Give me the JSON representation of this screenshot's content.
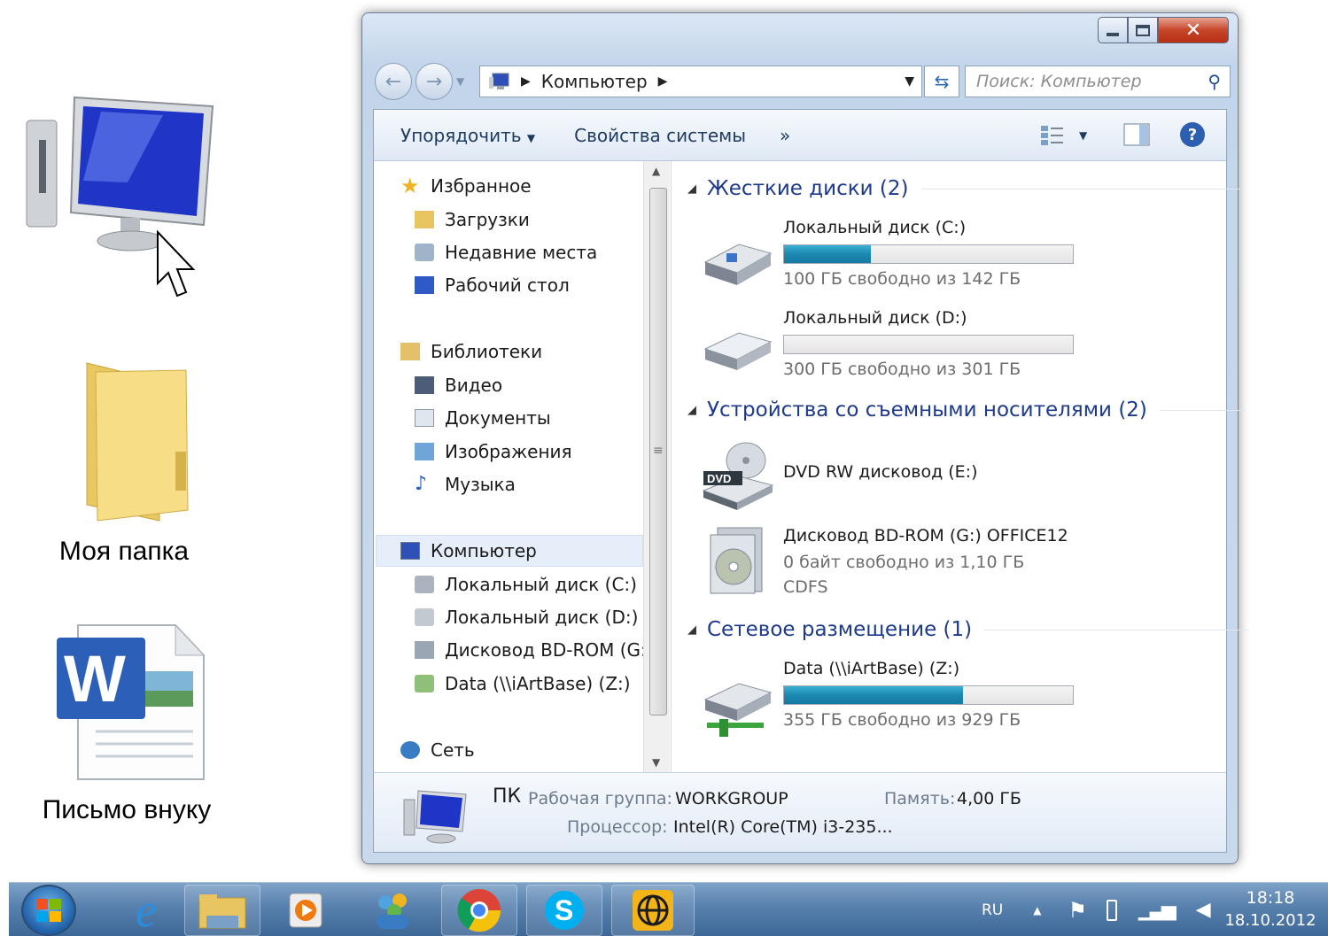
{
  "desktop": {
    "icons": [
      {
        "label": "",
        "icon": "computer-icon"
      },
      {
        "label": "Моя папка",
        "icon": "folder-icon"
      },
      {
        "label": "Письмо внуку",
        "icon": "word-document-icon"
      }
    ]
  },
  "window": {
    "address": {
      "path": "Компьютер"
    },
    "search": {
      "placeholder": "Поиск: Компьютер"
    },
    "toolbar": {
      "organize": "Упорядочить",
      "system_properties": "Свойства системы",
      "more": "»"
    },
    "nav": {
      "favorites": "Избранное",
      "downloads": "Загрузки",
      "recent": "Недавние места",
      "desktop": "Рабочий стол",
      "libraries": "Библиотеки",
      "video": "Видео",
      "documents": "Документы",
      "pictures": "Изображения",
      "music": "Музыка",
      "computer": "Компьютер",
      "disk_c": "Локальный диск (C:)",
      "disk_d": "Локальный диск (D:)",
      "bd_rom": "Дисковод BD-ROM (G:)",
      "network_drive": "Data (\\\\iArtBase) (Z:)",
      "network": "Сеть"
    },
    "groups": {
      "hard_drives": "Жесткие диски (2)",
      "removable": "Устройства со съемными носителями (2)",
      "network_locations": "Сетевое размещение (1)"
    },
    "drives": {
      "c": {
        "name": "Локальный диск (C:)",
        "free": "100 ГБ свободно из 142 ГБ",
        "used_fraction": 0.3
      },
      "d": {
        "name": "Локальный диск (D:)",
        "free": "300 ГБ свободно из 301 ГБ",
        "used_fraction": 0.0
      },
      "e": {
        "name": "DVD RW дисковод (E:)",
        "badge": "DVD"
      },
      "g": {
        "name": "Дисковод BD-ROM (G:) OFFICE12",
        "free": "0 байт свободно из 1,10 ГБ",
        "fs": "CDFS"
      },
      "z": {
        "name": "Data (\\\\iArtBase) (Z:)",
        "free": "355 ГБ свободно из 929 ГБ",
        "used_fraction": 0.62
      }
    },
    "details": {
      "name": "ПК",
      "workgroup_label": "Рабочая группа:",
      "workgroup_value": "WORKGROUP",
      "memory_label": "Память:",
      "memory_value": "4,00 ГБ",
      "cpu_label": "Процессор:",
      "cpu_value": "Intel(R) Core(TM) i3-235..."
    }
  },
  "taskbar": {
    "lang": "RU",
    "time": "18:18",
    "date": "18.10.2012"
  }
}
